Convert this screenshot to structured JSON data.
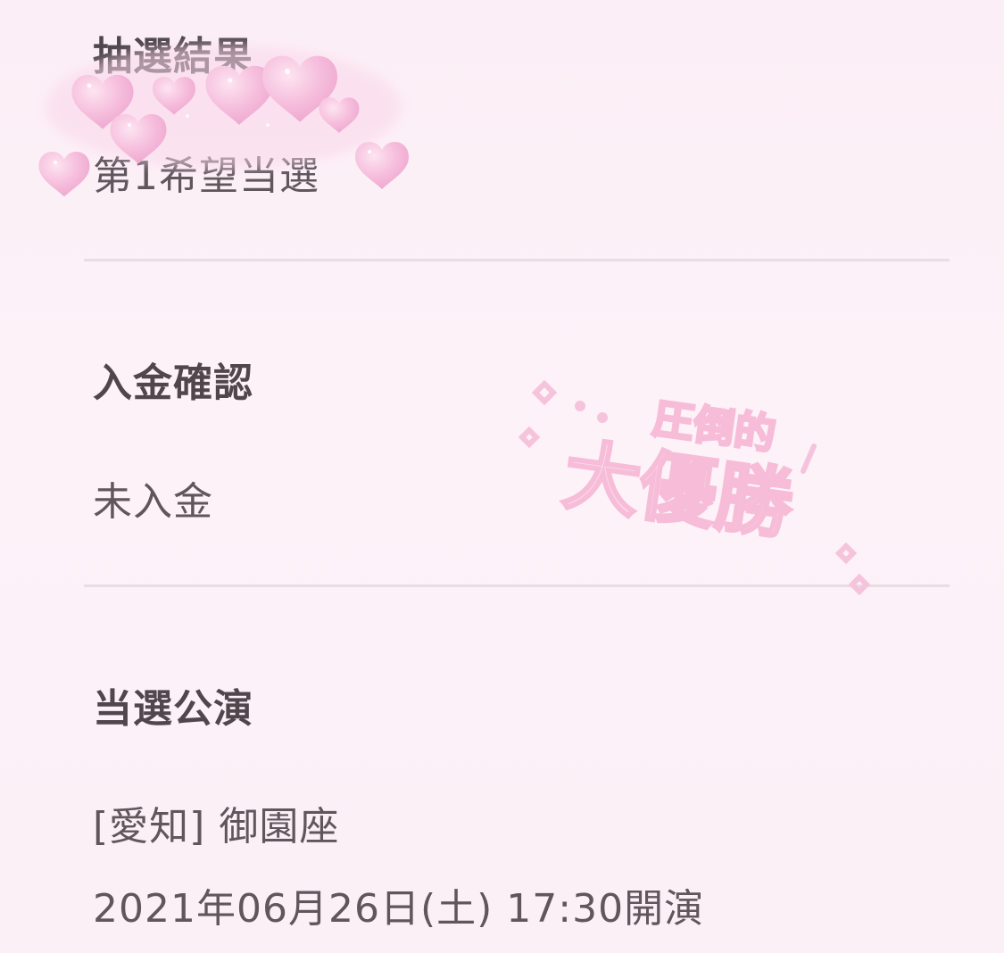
{
  "lottery_result": {
    "heading": "抽選結果",
    "value": "第1希望当選"
  },
  "payment_confirmation": {
    "heading": "入金確認",
    "value": "未入金"
  },
  "winning_performance": {
    "heading": "当選公演",
    "venue": "[愛知] 御園座",
    "datetime": "2021年06月26日(土) 17:30開演"
  },
  "sticker": {
    "line1": "圧倒的",
    "line2": "大優勝"
  },
  "colors": {
    "background": "#fcf0f7",
    "heart": "#f5b8dc",
    "divider": "#e8dde3"
  }
}
